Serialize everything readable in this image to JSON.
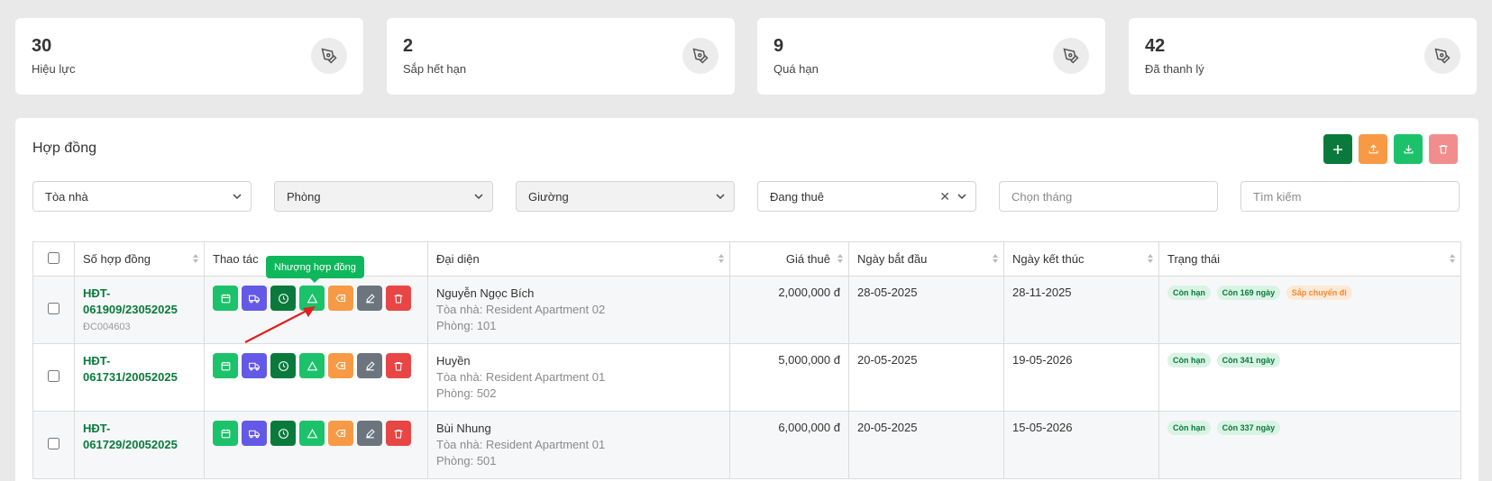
{
  "stats": [
    {
      "value": "30",
      "label": "Hiệu lực"
    },
    {
      "value": "2",
      "label": "Sắp hết hạn"
    },
    {
      "value": "9",
      "label": "Quá hạn"
    },
    {
      "value": "42",
      "label": "Đã thanh lý"
    }
  ],
  "page": {
    "title": "Hợp đồng"
  },
  "filters": {
    "building": "Tòa nhà",
    "room": "Phòng",
    "bed": "Giường",
    "status": "Đang thuê",
    "month_placeholder": "Chọn tháng",
    "search_placeholder": "Tìm kiếm"
  },
  "table": {
    "headers": [
      "Số hợp đồng",
      "Thao tác",
      "Đại diện",
      "Giá thuê",
      "Ngày bắt đầu",
      "Ngày kết thúc",
      "Trạng thái"
    ],
    "rows": [
      {
        "contract_no": "HĐT-061909/23052025",
        "contract_sub": "ĐC004603",
        "rep_name": "Nguyễn Ngọc Bích",
        "rep_building": "Tòa nhà: Resident Apartment 02",
        "rep_room": "Phòng: 101",
        "price": "2,000,000 đ",
        "start": "28-05-2025",
        "end": "28-11-2025",
        "badges": [
          "Còn hạn",
          "Còn 169 ngày",
          "Sắp chuyển đi"
        ]
      },
      {
        "contract_no": "HĐT-061731/20052025",
        "contract_sub": "",
        "rep_name": "Huyền",
        "rep_building": "Tòa nhà: Resident Apartment 01",
        "rep_room": "Phòng: 502",
        "price": "5,000,000 đ",
        "start": "20-05-2025",
        "end": "19-05-2026",
        "badges": [
          "Còn hạn",
          "Còn 341 ngày"
        ]
      },
      {
        "contract_no": "HĐT-061729/20052025",
        "contract_sub": "",
        "rep_name": "Bùi Nhung",
        "rep_building": "Tòa nhà: Resident Apartment 01",
        "rep_room": "Phòng: 501",
        "price": "6,000,000 đ",
        "start": "20-05-2025",
        "end": "15-05-2026",
        "badges": [
          "Còn hạn",
          "Còn 337 ngày"
        ]
      }
    ]
  },
  "tooltip": "Nhượng hợp đồng",
  "colors": {
    "dark_green": "#0a7a3c",
    "green": "#1cc269",
    "purple": "#6459e6",
    "orange": "#f89a45",
    "gray": "#6c757d",
    "red": "#e84545",
    "pink_red": "#f28d8d"
  },
  "icons": {
    "stat": "pen-nib-icon",
    "toolbar": [
      "plus-icon",
      "upload-icon",
      "download-icon",
      "trash-icon"
    ],
    "actions": [
      "calendar-icon",
      "truck-icon",
      "clock-icon",
      "triangle-icon",
      "backspace-icon",
      "edit-icon",
      "trash-icon"
    ]
  }
}
